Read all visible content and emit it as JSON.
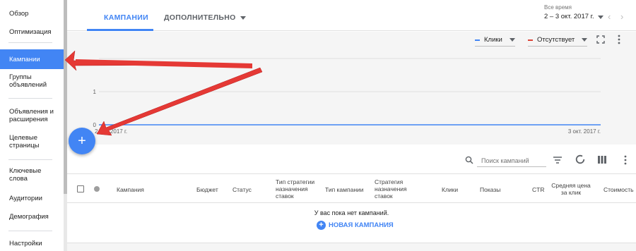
{
  "sidebar": {
    "items": [
      {
        "label": "Обзор"
      },
      {
        "label": "Оптимизация"
      },
      {
        "label": "Кампании"
      },
      {
        "label": "Группы объявлений"
      },
      {
        "label": "Объявления и расширения"
      },
      {
        "label": "Целевые страницы"
      },
      {
        "label": "Ключевые слова"
      },
      {
        "label": "Аудитории"
      },
      {
        "label": "Демография"
      },
      {
        "label": "Настройки"
      }
    ],
    "active_index": 2
  },
  "tabs": {
    "campaigns": "КАМПАНИИ",
    "more": "ДОПОЛНИТЕЛЬНО"
  },
  "date_range": {
    "label": "Все время",
    "value": "2 – 3 окт. 2017 г."
  },
  "chart_controls": {
    "metric1": "Клики",
    "metric2": "Отсутствует",
    "metric1_color": "#4285f4",
    "metric2_color": "#db4437"
  },
  "chart_data": {
    "type": "line",
    "x": [
      "2 окт. 2017 г.",
      "3 окт. 2017 г."
    ],
    "series": [
      {
        "name": "Клики",
        "values": [
          0,
          0
        ]
      }
    ],
    "ylim": [
      0,
      2
    ],
    "yticks": [
      "0",
      "1"
    ],
    "x_start_label": "2 окт. 2017 г.",
    "x_end_label": "3 окт. 2017 г.",
    "grid": true
  },
  "fab": {
    "label": "+"
  },
  "search": {
    "placeholder": "Поиск кампаний"
  },
  "table": {
    "columns": [
      "Кампания",
      "Бюджет",
      "Статус",
      "Тип стратегии назначения ставок",
      "Тип кампании",
      "Стратегия назначения ставок",
      "Клики",
      "Показы",
      "CTR",
      "Средняя цена за клик",
      "Стоимость"
    ],
    "empty_message": "У вас пока нет кампаний.",
    "new_campaign": "НОВАЯ КАМПАНИЯ"
  },
  "colors": {
    "accent": "#4285f4",
    "annotation_arrow": "#e53935"
  }
}
